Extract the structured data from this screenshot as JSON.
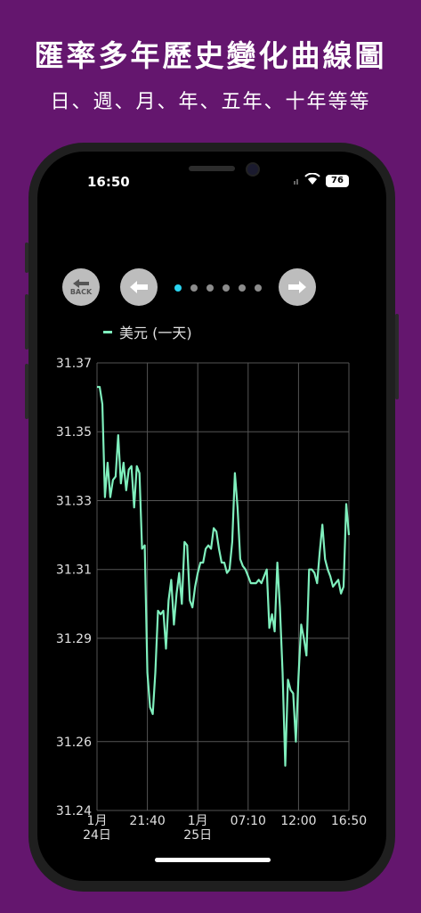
{
  "promo": {
    "title": "匯率多年歷史變化曲線圖",
    "subtitle": "日、週、月、年、五年、十年等等"
  },
  "status_bar": {
    "time": "16:50",
    "battery": "76"
  },
  "nav": {
    "back_label": "BACK",
    "page_count": 6,
    "active_page": 0
  },
  "colors": {
    "background": "#64166e",
    "line": "#7fefbd",
    "grid": "#555555",
    "active_dot": "#2ad4f0"
  },
  "chart_data": {
    "type": "line",
    "series": [
      {
        "name": "美元 (一天)",
        "values": [
          31.363,
          31.363,
          31.358,
          31.331,
          31.341,
          31.331,
          31.336,
          31.337,
          31.349,
          31.335,
          31.341,
          31.333,
          31.339,
          31.34,
          31.328,
          31.34,
          31.338,
          31.316,
          31.317,
          31.28,
          31.27,
          31.268,
          31.28,
          31.298,
          31.297,
          31.298,
          31.287,
          31.301,
          31.307,
          31.294,
          31.303,
          31.309,
          31.3,
          31.318,
          31.317,
          31.301,
          31.299,
          31.305,
          31.309,
          31.312,
          31.312,
          31.316,
          31.317,
          31.316,
          31.322,
          31.321,
          31.316,
          31.312,
          31.312,
          31.309,
          31.31,
          31.318,
          31.338,
          31.328,
          31.313,
          31.311,
          31.31,
          31.308,
          31.306,
          31.306,
          31.306,
          31.307,
          31.306,
          31.308,
          31.31,
          31.293,
          31.297,
          31.292,
          31.312,
          31.299,
          31.28,
          31.253,
          31.278,
          31.275,
          31.274,
          31.26,
          31.279,
          31.294,
          31.29,
          31.285,
          31.31,
          31.31,
          31.309,
          31.306,
          31.315,
          31.323,
          31.313,
          31.31,
          31.308,
          31.305,
          31.306,
          31.307,
          31.303,
          31.305,
          31.329,
          31.32
        ]
      }
    ],
    "x_ticks": [
      "1月\n24日",
      "21:40",
      "1月\n25日",
      "07:10",
      "12:00",
      "16:50"
    ],
    "y_ticks": [
      "31.37",
      "31.35",
      "31.33",
      "31.31",
      "31.29",
      "31.26",
      "31.24"
    ],
    "ylim": [
      31.24,
      31.37
    ],
    "grid": true,
    "legend": "top-left"
  }
}
